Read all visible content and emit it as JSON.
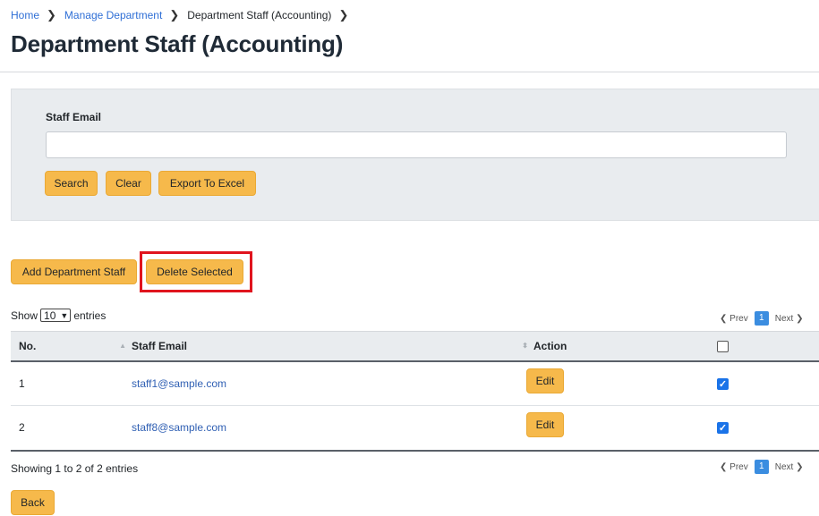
{
  "breadcrumb": {
    "home": "Home",
    "manage": "Manage Department",
    "current": "Department Staff (Accounting)",
    "separator": "❯"
  },
  "page_title": "Department Staff (Accounting)",
  "filter": {
    "label": "Staff Email",
    "value": "",
    "placeholder": "",
    "search": "Search",
    "clear": "Clear",
    "export": "Export To Excel"
  },
  "actions": {
    "add": "Add Department Staff",
    "delete": "Delete Selected",
    "highlighted": "Delete Selected"
  },
  "length": {
    "show": "Show",
    "value": "10",
    "entries": "entries"
  },
  "pager": {
    "prev": "Prev",
    "page": "1",
    "next": "Next"
  },
  "table": {
    "headers": {
      "no": "No.",
      "email": "Staff Email",
      "action": "Action"
    },
    "rows": [
      {
        "no": "1",
        "email": "staff1@sample.com",
        "edit": "Edit",
        "checked": true
      },
      {
        "no": "2",
        "email": "staff8@sample.com",
        "edit": "Edit",
        "checked": true
      }
    ]
  },
  "info": "Showing 1 to 2 of 2 entries",
  "back": "Back",
  "colors": {
    "accent": "#f6b94b",
    "link": "#2f6fd6",
    "highlight": "#e0141e",
    "page_active": "#3b8de0"
  }
}
